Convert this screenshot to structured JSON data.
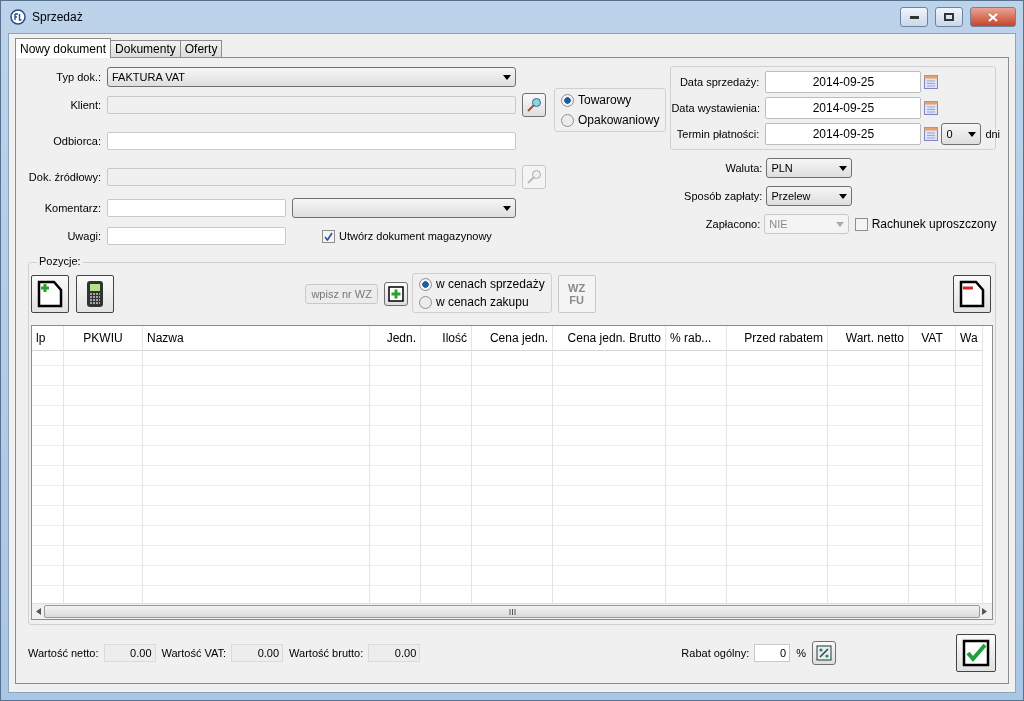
{
  "window": {
    "title": "Sprzedaż"
  },
  "tabs": [
    {
      "label": "Nowy dokument",
      "selected": true
    },
    {
      "label": "Dokumenty",
      "selected": false
    },
    {
      "label": "Oferty",
      "selected": false
    }
  ],
  "form": {
    "typ_dok": {
      "label": "Typ dok.:",
      "value": "FAKTURA VAT"
    },
    "klient": {
      "label": "Klient:",
      "disabled": true
    },
    "odbiorca": {
      "label": "Odbiorca:",
      "disabled": false
    },
    "dok_zrodlowy": {
      "label": "Dok. źródłowy:",
      "disabled": true
    },
    "komentarz": {
      "label": "Komentarz:"
    },
    "uwagi": {
      "label": "Uwagi:"
    },
    "create_warehouse_doc": {
      "label": "Utwórz dokument magazynowy",
      "checked": true
    }
  },
  "type_options": [
    {
      "label": "Towarowy",
      "selected": true
    },
    {
      "label": "Opakowaniowy",
      "selected": false
    }
  ],
  "dates": [
    {
      "label": "Data sprzedaży:",
      "value": "2014-09-25"
    },
    {
      "label": "Data wystawienia:",
      "value": "2014-09-25"
    },
    {
      "label": "Termin płatności:",
      "value": "2014-09-25"
    }
  ],
  "payment_days": {
    "value": "0",
    "unit": "dni"
  },
  "waluta": {
    "label": "Waluta:",
    "value": "PLN",
    "disabled": false
  },
  "sposob_zaplaty": {
    "label": "Sposób zapłaty:",
    "value": "Przelew",
    "disabled": false
  },
  "zaplacono": {
    "label": "Zapłacono:",
    "value": "NIE",
    "disabled": true
  },
  "simplified_bill": {
    "label": "Rachunek uproszczony",
    "checked": false
  },
  "positions": {
    "title": "Pozycje:",
    "wz_button": "wpisz nr WZ",
    "price_options": [
      {
        "label": "w cenach sprzedaży",
        "selected": true
      },
      {
        "label": "w cenach zakupu",
        "selected": false
      }
    ],
    "wz_fu_button": {
      "top": "WZ",
      "bottom": "FU",
      "disabled": true
    },
    "columns": [
      "lp",
      "PKWIU",
      "Nazwa",
      "Jedn.",
      "Ilość",
      "Cena jedn.",
      "Cena jedn. Brutto",
      "% rab...",
      "Przed rabatem",
      "Wart. netto",
      "VAT",
      "Wa"
    ]
  },
  "totals": [
    {
      "label": "Wartość netto:",
      "value": "0.00"
    },
    {
      "label": "Wartość VAT:",
      "value": "0.00"
    },
    {
      "label": "Wartość brutto:",
      "value": "0.00"
    }
  ],
  "discount": {
    "label": "Rabat ogólny:",
    "value": "0",
    "unit": "%"
  }
}
